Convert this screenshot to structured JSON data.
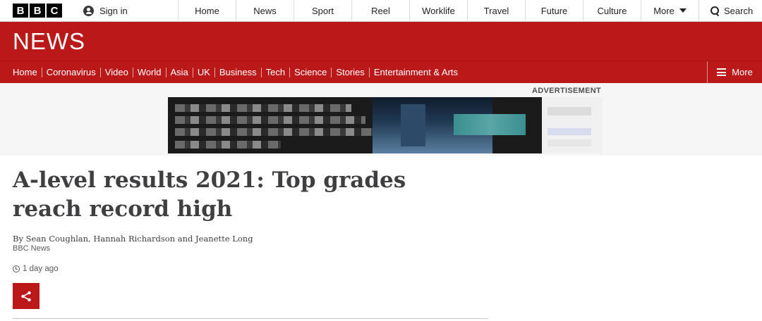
{
  "logo": {
    "letters": [
      "B",
      "B",
      "C"
    ]
  },
  "signin": {
    "label": "Sign in",
    "icon": "user-icon"
  },
  "topnav": {
    "items": [
      "Home",
      "News",
      "Sport",
      "Reel",
      "Worklife",
      "Travel",
      "Future",
      "Culture"
    ],
    "more_label": "More",
    "search_label": "Search"
  },
  "header": {
    "brand": "NEWS"
  },
  "sections": {
    "links": [
      "Home",
      "Coronavirus",
      "Video",
      "World",
      "Asia",
      "UK",
      "Business",
      "Tech",
      "Science",
      "Stories",
      "Entertainment & Arts"
    ],
    "more_label": "More"
  },
  "advert": {
    "label": "ADVERTISEMENT"
  },
  "article": {
    "headline": "A-level results 2021: Top grades reach record high",
    "byline": "By Sean Coughlan, Hannah Richardson and Jeanette Long",
    "source": "BBC News",
    "timestamp": "1 day ago"
  },
  "colors": {
    "brand_red": "#bb1919",
    "headline": "#3f3f42"
  }
}
